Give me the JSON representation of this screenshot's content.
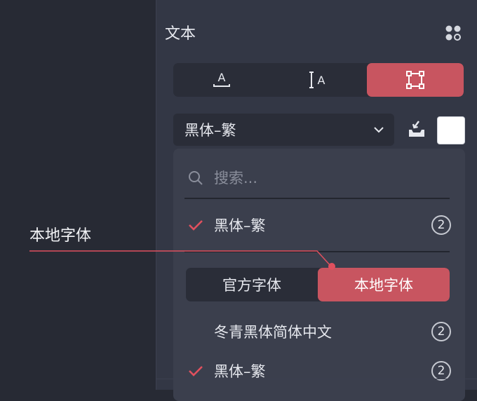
{
  "panel": {
    "title": "文本"
  },
  "text_tabs": {
    "items": [
      {
        "id": "text-baseline",
        "icon": "text-baseline-icon",
        "active": false
      },
      {
        "id": "text-height",
        "icon": "text-height-icon",
        "active": false
      },
      {
        "id": "text-box",
        "icon": "bounding-box-icon",
        "active": true
      }
    ]
  },
  "font_select": {
    "value": "黑体–繁"
  },
  "color": {
    "value": "#ffffff"
  },
  "dropdown": {
    "search_placeholder": "搜索...",
    "selected_font": {
      "name": "黑体–繁",
      "count": "2"
    },
    "source_tabs": [
      {
        "label": "官方字体",
        "active": false
      },
      {
        "label": "本地字体",
        "active": true
      }
    ],
    "fonts": [
      {
        "name": "冬青黑体简体中文",
        "count": "2",
        "checked": false
      },
      {
        "name": "黑体–繁",
        "count": "2",
        "checked": true
      }
    ]
  },
  "annotation": {
    "label": "本地字体"
  },
  "colors": {
    "accent": "#c85560",
    "panel": "#333745",
    "dropdown": "#3b3f4d",
    "annotation_line": "#e0505e"
  }
}
